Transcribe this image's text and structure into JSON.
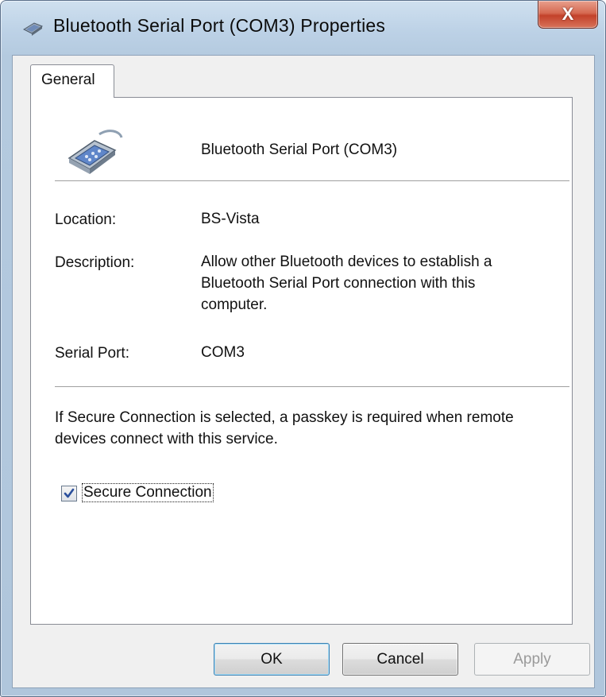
{
  "window": {
    "title": "Bluetooth Serial Port (COM3) Properties",
    "close_label": "X",
    "title_icon": "bluetooth-device-icon"
  },
  "tabs": [
    {
      "label": "General",
      "selected": true
    }
  ],
  "general": {
    "device_icon": "serial-port-connector-icon",
    "device_name": "Bluetooth Serial Port (COM3)",
    "location_label": "Location:",
    "location_value": "BS-Vista",
    "description_label": "Description:",
    "description_value": "Allow other Bluetooth devices to establish a Bluetooth Serial Port connection with this computer.",
    "serial_port_label": "Serial Port:",
    "serial_port_value": "COM3",
    "secure_note": "If Secure Connection is selected, a passkey is required when remote devices connect with this service.",
    "secure_connection_label": "Secure Connection",
    "secure_connection_checked": true
  },
  "buttons": {
    "ok": "OK",
    "cancel": "Cancel",
    "apply": "Apply",
    "apply_enabled": false
  },
  "colors": {
    "title_gradient": "#bcd1e6",
    "close_red": "#c3412a",
    "default_button_border": "#3c7fb1"
  }
}
